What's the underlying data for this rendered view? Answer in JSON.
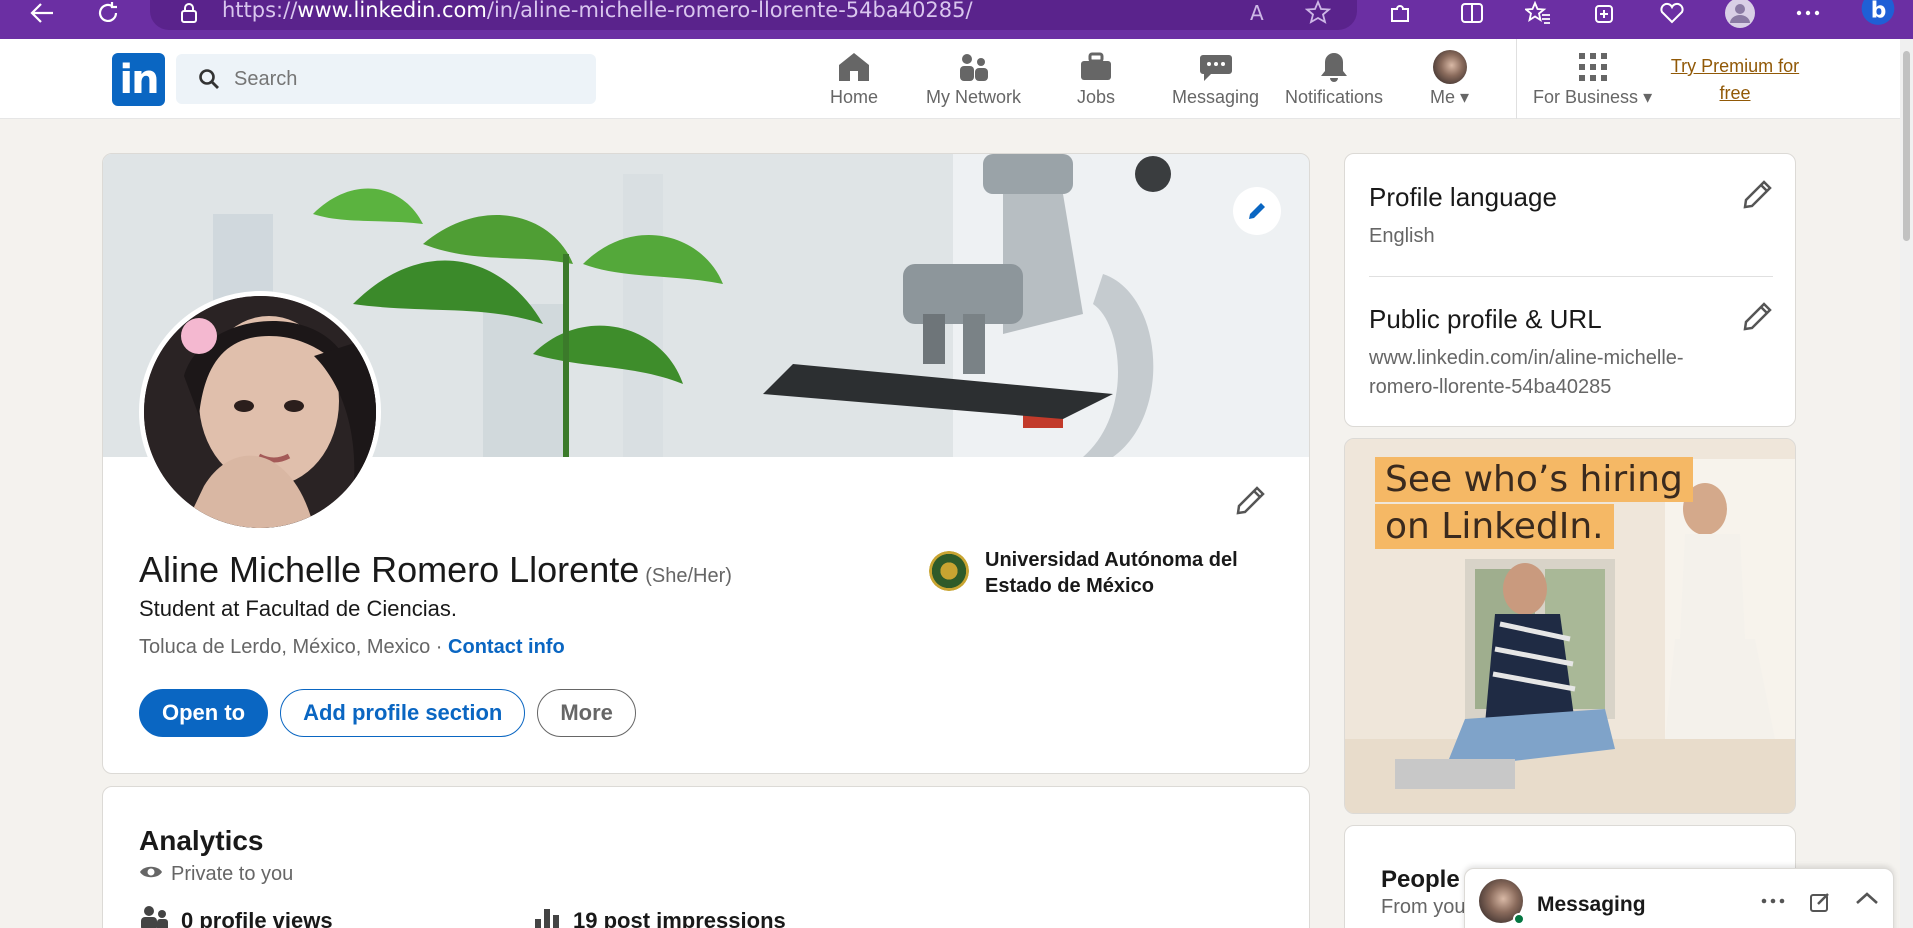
{
  "browser": {
    "url_prefix": "https://",
    "url_domain": "www.linkedin.com",
    "url_path": "/in/aline-michelle-romero-llorente-54ba40285/"
  },
  "header": {
    "search_placeholder": "Search",
    "nav": [
      {
        "label": "Home",
        "icon": "home-icon"
      },
      {
        "label": "My Network",
        "icon": "network-icon"
      },
      {
        "label": "Jobs",
        "icon": "briefcase-icon"
      },
      {
        "label": "Messaging",
        "icon": "chat-icon"
      },
      {
        "label": "Notifications",
        "icon": "bell-icon"
      },
      {
        "label": "Me",
        "icon": "avatar"
      },
      {
        "label": "For Business",
        "icon": "grid-icon"
      }
    ],
    "premium_line1": "Try Premium for",
    "premium_line2": "free"
  },
  "profile": {
    "name": "Aline Michelle Romero Llorente",
    "pronouns": "(She/Her)",
    "headline": "Student at Facultad de Ciencias.",
    "location": "Toluca de Lerdo, México, Mexico",
    "location_sep": " · ",
    "contact_link": "Contact info",
    "school": "Universidad Autónoma del Estado de México",
    "buttons": {
      "open_to": "Open to",
      "add_section": "Add profile section",
      "more": "More"
    }
  },
  "analytics": {
    "title": "Analytics",
    "privacy": "Private to you",
    "profile_views": "0 profile views",
    "post_impressions": "19 post impressions"
  },
  "sidebar": {
    "language_title": "Profile language",
    "language_value": "English",
    "url_title": "Public profile & URL",
    "url_value": "www.linkedin.com/in/aline-michelle-romero-llorente-54ba40285"
  },
  "ad": {
    "line1": "See who’s hiring",
    "line2": "on LinkedIn."
  },
  "people": {
    "title": "People y",
    "subtitle": "From you"
  },
  "messaging": {
    "label": "Messaging"
  },
  "colors": {
    "browser_purple": "#6b2fa3",
    "linkedin_blue": "#0a66c2",
    "premium_gold": "#915907",
    "page_bg": "#f4f2ee"
  }
}
